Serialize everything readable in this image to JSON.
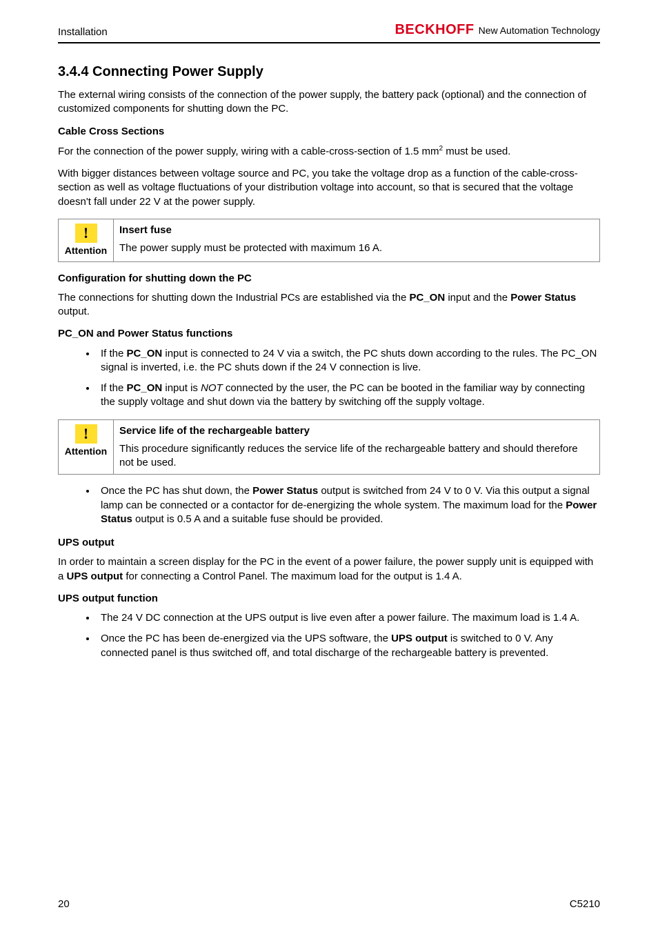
{
  "header": {
    "left": "Installation",
    "logo_text": "BECKHOFF",
    "logo_tag": "New Automation Technology"
  },
  "section": {
    "number_title": "3.4.4  Connecting Power Supply",
    "intro": "The external wiring consists of the connection of the power supply, the battery pack (optional) and the connection of customized components for shutting down the PC."
  },
  "cable": {
    "heading": "Cable Cross Sections",
    "para1_a": "For the connection of the power supply, wiring  with a cable-cross-section of 1.5 mm",
    "para1_sup": "2",
    "para1_b": "  must be used.",
    "para2": "With bigger distances between voltage source and PC, you take the voltage drop as a function of the cable-cross-section as well as voltage fluctuations of your distribution voltage into account, so that is secured that the voltage doesn't fall under 22 V at the power supply."
  },
  "attention_label": "Attention",
  "fuse_box": {
    "title": "Insert fuse",
    "body": "The power supply must be protected with maximum 16 A."
  },
  "config": {
    "heading": "Configuration for shutting down the PC",
    "para_a": "The connections for shutting down the Industrial PCs are established via the ",
    "pc_on": "PC_ON",
    "para_b": " input and the ",
    "power_status": "Power Status",
    "para_c": " output."
  },
  "pcon_funcs": {
    "heading": "PC_ON and Power Status functions",
    "b1_a": "If the ",
    "b1_pc_on": "PC_ON",
    "b1_b": " input is connected to 24 V via a switch, the PC shuts down according to the rules. The PC_ON signal is inverted, i.e. the PC shuts down if the 24 V connection is live.",
    "b2_a": "If the ",
    "b2_pc_on": "PC_ON",
    "b2_b": " input is ",
    "b2_not": "NOT",
    "b2_c": " connected by the user, the PC can be booted in the familiar way by connecting the supply voltage and shut down via the battery by switching off the supply voltage."
  },
  "battery_box": {
    "title": "Service life of the rechargeable battery",
    "body": "This procedure significantly reduces the service life of the rechargeable battery and should therefore not be used."
  },
  "after_battery": {
    "b1_a": "Once the PC has shut down, the ",
    "b1_ps": "Power Status",
    "b1_b": " output is switched from 24 V to 0 V. Via this output a signal lamp can be connected or a contactor for de-energizing the whole system. The maximum load for the ",
    "b1_ps2": "Power Status",
    "b1_c": " output is 0.5 A and a suitable fuse should be provided."
  },
  "ups_out": {
    "heading": "UPS output",
    "para_a": "In order to maintain a screen display for the PC in the event of a power failure, the power supply unit is equipped with a ",
    "ups_bold": "UPS output",
    "para_b": " for connecting a Control Panel. The maximum load for the output is 1.4 A."
  },
  "ups_func": {
    "heading": "UPS output function",
    "b1": "The 24 V DC connection at the UPS output is live even after a power failure. The maximum load is 1.4 A.",
    "b2_a": "Once the PC has been de-energized via the UPS software, the ",
    "b2_ups": "UPS output",
    "b2_b": " is switched to 0 V. Any connected panel is thus switched off, and total discharge of the rechargeable battery is prevented."
  },
  "footer": {
    "page": "20",
    "doc": "C5210"
  }
}
